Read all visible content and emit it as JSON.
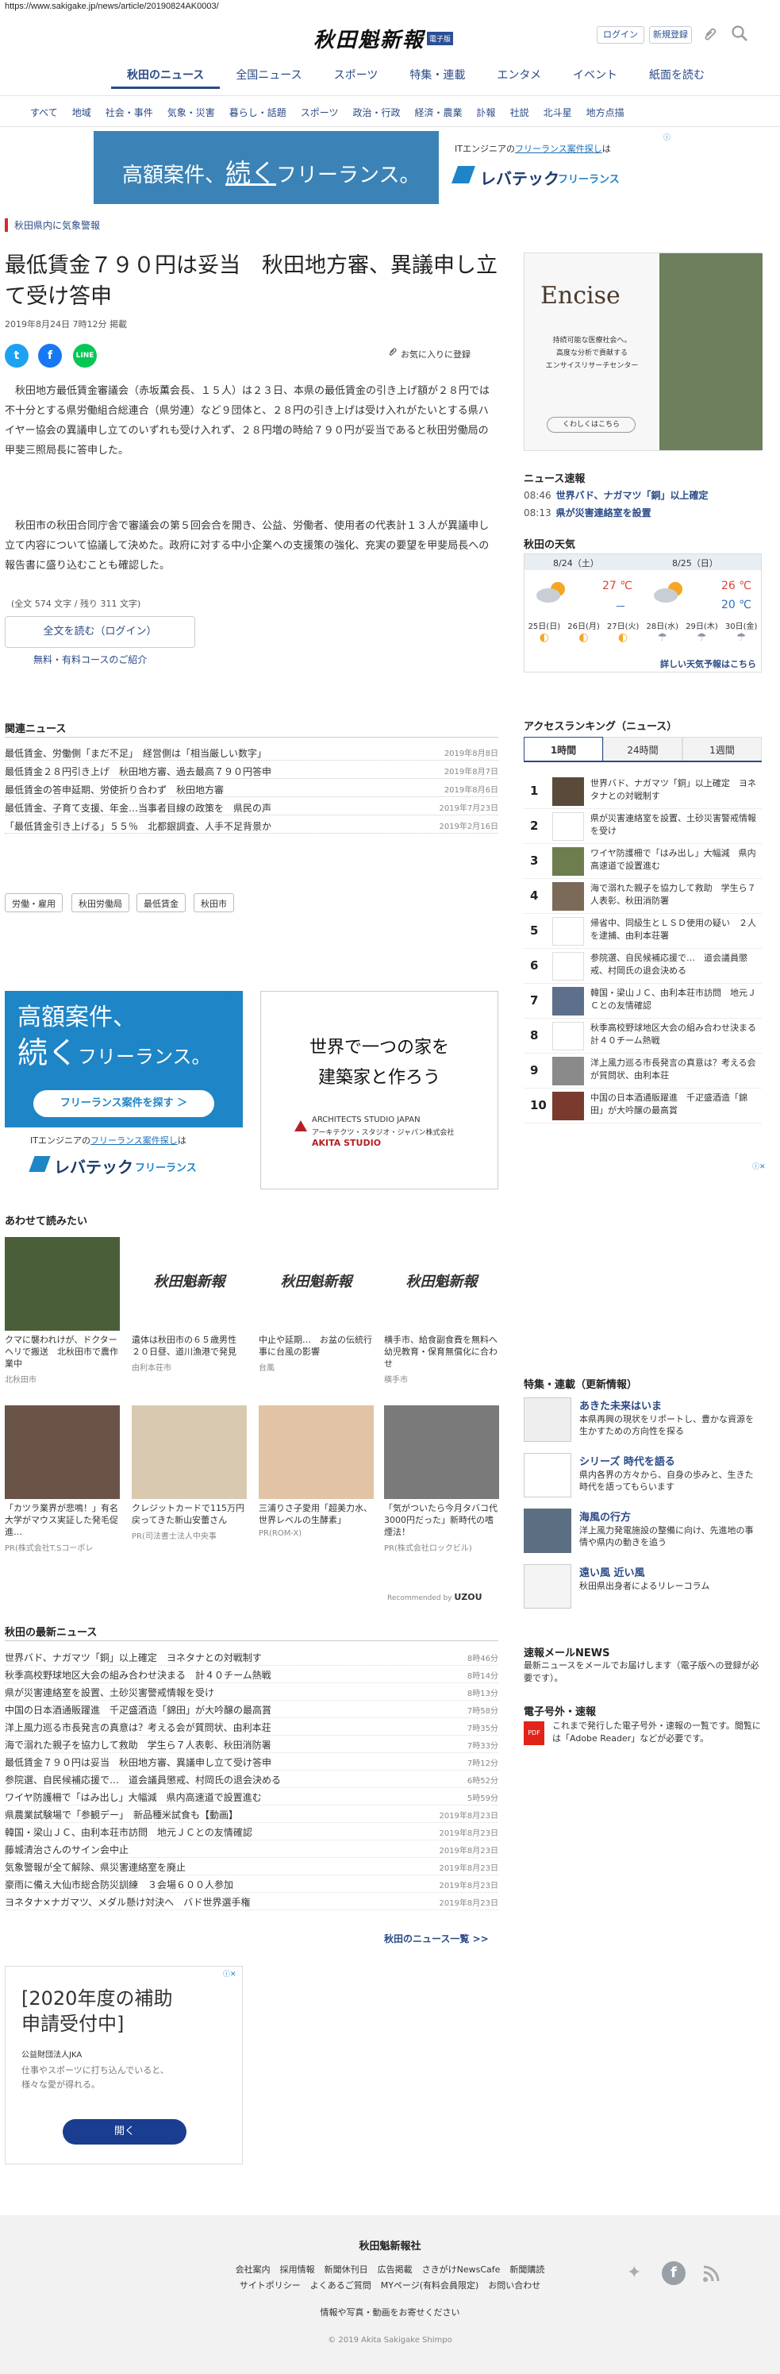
{
  "url": "https://www.sakigake.jp/news/article/20190824AK0003/",
  "header": {
    "logo": "秋田魁新報",
    "badge": "電子版",
    "login": "ログイン",
    "register": "新規登録"
  },
  "nav": [
    "秋田のニュース",
    "全国ニュース",
    "スポーツ",
    "特集・連載",
    "エンタメ",
    "イベント",
    "紙面を読む"
  ],
  "subnav": [
    "すべて",
    "地域",
    "社会・事件",
    "気象・災害",
    "暮らし・話題",
    "スポーツ",
    "政治・行政",
    "経済・農業",
    "訃報",
    "社説",
    "北斗星",
    "地方点描"
  ],
  "topad": {
    "headline_a": "高額案件、",
    "headline_b": "続く",
    "headline_c": "フリーランス。",
    "right_small_a": "ITエンジニアの",
    "right_small_b": "フリーランス案件探し",
    "right_small_c": "は",
    "brand": "レバテック",
    "brand_sub": "フリーランス"
  },
  "alert": "秋田県内に気象警報",
  "article": {
    "title": "最低賃金７９０円は妥当　秋田地方審、異議申し立て受け答申",
    "date": "2019年8月24日 7時12分 掲載",
    "favorite": "お気に入りに登録",
    "p1": "秋田地方最低賃金審議会（赤坂薫会長、１５人）は２３日、本県の最低賃金の引き上げ額が２８円では不十分とする県労働組合総連合（県労連）など９団体と、２８円の引き上げは受け入れがたいとする県ハイヤー協会の異議申し立てのいずれも受け入れず、２８円増の時給７９０円が妥当であると秋田労働局の甲斐三照局長に答申した。",
    "p2": "秋田市の秋田合同庁舎で審議会の第５回会合を開き、公益、労働者、使用者の代表計１３人が異議申し立て内容について協議して決めた。政府に対する中小企業への支援策の強化、充実の要望を甲斐局長への報告書に盛り込むことも確認した。",
    "count": "(全文 574 文字 / 残り 311 文字)",
    "read_btn": "全文を読む（ログイン）",
    "free_link": "無料・有料コースのご紹介"
  },
  "related_heading": "関連ニュース",
  "related": [
    {
      "t": "最低賃金、労働側「まだ不足」　経営側は「相当厳しい数字」",
      "d": "2019年8月8日"
    },
    {
      "t": "最低賃金２８円引き上げ　秋田地方審、過去最高７９０円答申",
      "d": "2019年8月7日"
    },
    {
      "t": "最低賃金の答申延期、労使折り合わず　秋田地方審",
      "d": "2019年8月6日"
    },
    {
      "t": "最低賃金、子育て支援、年金…当事者目線の政策を　県民の声",
      "d": "2019年7月23日"
    },
    {
      "t": "「最低賃金引き上げる」５５％　北都銀調査、人手不足背景か",
      "d": "2019年2月16日"
    }
  ],
  "tags": [
    "労働・雇用",
    "秋田労働局",
    "最低賃金",
    "秋田市"
  ],
  "ad_left": {
    "l1": "高額案件、",
    "l2": "続く",
    "l3": "フリーランス。",
    "btn": "フリーランス案件を探す ＞",
    "foot_a": "ITエンジニアの",
    "foot_b": "フリーランス案件探し",
    "foot_c": "は",
    "brand": "レバテック",
    "brand_sub": "フリーランス"
  },
  "ad_right": {
    "l1": "世界で一つの家を",
    "l2": "建築家と作ろう",
    "c1": "ARCHITECTS STUDIO JAPAN",
    "c2": "アーキテクツ・スタジオ・ジャパン株式会社",
    "c3": "AKITA STUDIO"
  },
  "also_heading": "あわせて読みたい",
  "also": [
    {
      "t": "クマに襲われけが、ドクターヘリで搬送　北秋田市で農作業中",
      "s": "北秋田市"
    },
    {
      "t": "遺体は秋田市の６５歳男性　２０日昼、道川漁港で発見",
      "s": "由利本荘市"
    },
    {
      "t": "中止や延期…　お盆の伝統行事に台風の影響",
      "s": "台風"
    },
    {
      "t": "横手市、給食副食費を無料へ　幼児教育・保育無償化に合わせ",
      "s": "横手市"
    },
    {
      "t": "「カツラ業界が悲鳴！」有名大学がマウス実証した発毛促進…",
      "s": "PR(株式会社T.Sコーポレ"
    },
    {
      "t": "クレジットカードで115万円戻ってきた新山安蕾さん",
      "s": "PR(司法書士法人中央事"
    },
    {
      "t": "三浦りさ子愛用「超美力水、世界レベルの生酵素」",
      "s": "PR(ROM-X)"
    },
    {
      "t": "「気がついたら今月タバコ代3000円だった」新時代の嗜煙法！",
      "s": "PR(株式会社ロックビル)"
    }
  ],
  "recommended": "Recommended by",
  "recommended_brand": "UZOU",
  "latest_heading": "秋田の最新ニュース",
  "latest": [
    {
      "t": "世界バド、ナガマツ「銅」以上確定　ヨネタナとの対戦制す",
      "d": "8時46分"
    },
    {
      "t": "秋季高校野球地区大会の組み合わせ決まる　計４０チーム熱戦",
      "d": "8時14分"
    },
    {
      "t": "県が災害連絡室を設置、土砂災害警戒情報を受け",
      "d": "8時13分"
    },
    {
      "t": "中国の日本酒通販躍進　千疋盛酒造「錦田」が大吟醸の最高賞",
      "d": "7時58分"
    },
    {
      "t": "洋上風力巡る市長発言の真意は？考える会が質問状、由利本荘",
      "d": "7時35分"
    },
    {
      "t": "海で溺れた親子を協力して救助　学生ら７人表彰、秋田消防署",
      "d": "7時33分"
    },
    {
      "t": "最低賃金７９０円は妥当　秋田地方審、異議申し立て受け答申",
      "d": "7時12分"
    },
    {
      "t": "参院選、自民候補応援で…　道会議員懲戒、村岡氏の退会決める",
      "d": "6時52分"
    },
    {
      "t": "ワイヤ防護柵で「はみ出し」大幅減　県内高速道で設置進む",
      "d": "5時59分"
    },
    {
      "t": "県農業試験場で「参観デー」　新品種米試食も【動画】",
      "d": "2019年8月23日"
    },
    {
      "t": "韓国・梁山ＪＣ、由利本荘市訪問　地元ＪＣとの友情確認",
      "d": "2019年8月23日"
    },
    {
      "t": "藤城清治さんのサイン会中止",
      "d": "2019年8月23日"
    },
    {
      "t": "気象警報が全て解除、県災害連絡室を廃止",
      "d": "2019年8月23日"
    },
    {
      "t": "豪雨に備え大仙市総合防災訓練　３会場６００人参加",
      "d": "2019年8月23日"
    },
    {
      "t": "ヨネタナ×ナガマツ、メダル懸け対決へ　バド世界選手権",
      "d": "2019年8月23日"
    }
  ],
  "latest_more": "秋田のニュース一覧 >>",
  "bottom_ad": {
    "l1": "[2020年度の補助",
    "l2": "申請受付中]",
    "org": "公益財団法人JKA",
    "d1": "仕事やスポーツに打ち込んでいると、",
    "d2": "様々な愛が得れる。",
    "btn": "開く"
  },
  "sidebar": {
    "ad": {
      "brand": "Encise",
      "l1": "持続可能な医療社会へ。",
      "l2": "高度な分析で貢献する",
      "l3": "エンサイスリサーチセンター",
      "btn": "くわしくはこちら"
    },
    "flash_heading": "ニュース速報",
    "flash": [
      {
        "time": "08:46",
        "t": "世界バド、ナガマツ「銅」以上確定"
      },
      {
        "time": "08:13",
        "t": "県が災害連絡室を設置"
      }
    ],
    "weather_heading": "秋田の天気",
    "weather": {
      "d1": "8/24（土）",
      "d2": "8/25（日）",
      "hi1": "27 ℃",
      "lo1": "－",
      "hi2": "26 ℃",
      "lo2": "20 ℃",
      "days": [
        "25日(日)",
        "26日(月)",
        "27日(火)",
        "28日(水)",
        "29日(木)",
        "30日(金)"
      ],
      "link": "詳しい天気予報はこちら"
    },
    "rank_heading": "アクセスランキング（ニュース）",
    "rank_tabs": [
      "1時間",
      "24時間",
      "1週間"
    ],
    "ranking": [
      "世界バド、ナガマツ「銅」以上確定　ヨネタナとの対戦制す",
      "県が災害連絡室を設置、土砂災害警戒情報を受け",
      "ワイヤ防護柵で「はみ出し」大幅減　県内高速道で設置進む",
      "海で溺れた親子を協力して救助　学生ら７人表彰、秋田消防署",
      "帰省中、同級生とＬＳＤ使用の疑い　２人を逮捕、由利本荘署",
      "参院選、自民候補応援で…　道会議員懲戒、村岡氏の退会決める",
      "韓国・梁山ＪＣ、由利本荘市訪問　地元ＪＣとの友情確認",
      "秋季高校野球地区大会の組み合わせ決まる　計４０チーム熱戦",
      "洋上風力巡る市長発言の真意は？考える会が質問状、由利本荘",
      "中国の日本酒通販躍進　千疋盛酒造「錦田」が大吟醸の最高賞"
    ],
    "feat_heading": "特集・連載（更新情報）",
    "features": [
      {
        "h": "あきた未来はいま",
        "t": "本県再興の現状をリポートし、豊かな資源を生かすための方向性を探る"
      },
      {
        "h": "シリーズ 時代を語る",
        "t": "県内各界の方々から、自身の歩みと、生きた時代を語ってもらいます"
      },
      {
        "h": "海風の行方",
        "t": "洋上風力発電施設の整備に向け、先進地の事情や県内の動きを追う"
      },
      {
        "h": "遠い風 近い風",
        "t": "秋田県出身者によるリレーコラム"
      }
    ],
    "mail_heading": "速報メールNEWS",
    "mail_t": "最新ニュースをメールでお届けします（電子版への登録が必要です）。",
    "paper_heading": "電子号外・速報",
    "paper_t": "これまで発行した電子号外・速報の一覧です。閲覧には「Adobe Reader」などが必要です。"
  },
  "footer": {
    "title": "秋田魁新報社",
    "row1": [
      "会社案内",
      "採用情報",
      "新聞休刊日",
      "広告掲載",
      "さきがけNewsCafe",
      "新聞購読"
    ],
    "row2": [
      "サイトポリシー",
      "よくあるご質問",
      "MYページ(有料会員限定)",
      "お問い合わせ"
    ],
    "row3": "情報や写真・動画をお寄せください",
    "copy": "© 2019 Akita Sakigake Shimpo"
  }
}
